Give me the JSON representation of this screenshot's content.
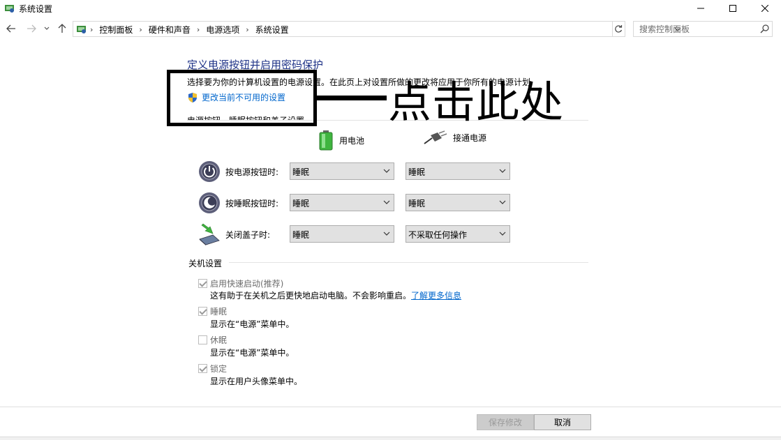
{
  "window": {
    "title": "系统设置"
  },
  "address": {
    "crumbs": [
      "控制面板",
      "硬件和声音",
      "电源选项",
      "系统设置"
    ]
  },
  "search": {
    "placeholder": "搜索控制面板"
  },
  "main": {
    "title": "定义电源按钮并启用密码保护",
    "description": "选择要为你的计算机设置的电源设置。在此页上对设置所做的更改将应用于你所有的电源计划",
    "change_link": "更改当前不可用的设置",
    "section_label": "电源按钮、睡眠按钮和盖子设置",
    "columns": {
      "battery": "用电池",
      "plugged": "接通电源"
    },
    "rows": [
      {
        "label": "按电源按钮时:",
        "battery": "睡眠",
        "plugged": "睡眠"
      },
      {
        "label": "按睡眠按钮时:",
        "battery": "睡眠",
        "plugged": "睡眠"
      },
      {
        "label": "关闭盖子时:",
        "battery": "睡眠",
        "plugged": "不采取任何操作"
      }
    ]
  },
  "annotation": {
    "text": "点击此处"
  },
  "shutdown": {
    "title": "关机设置",
    "items": [
      {
        "label": "启用快速启动(推荐)",
        "checked": true,
        "desc": "这有助于在关机之后更快地启动电脑。不会影响重启。",
        "link": "了解更多信息"
      },
      {
        "label": "睡眠",
        "checked": true,
        "desc": "显示在“电源”菜单中。"
      },
      {
        "label": "休眠",
        "checked": false,
        "desc": "显示在“电源”菜单中。"
      },
      {
        "label": "锁定",
        "checked": true,
        "desc": "显示在用户头像菜单中。"
      }
    ]
  },
  "footer": {
    "save": "保存修改",
    "cancel": "取消"
  },
  "colors": {
    "title_blue": "#1e3287",
    "link_blue": "#0066cc"
  }
}
